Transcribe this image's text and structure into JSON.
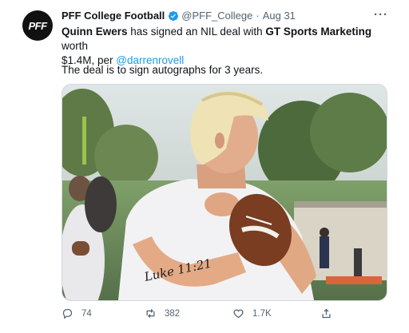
{
  "account": {
    "name": "PFF College Football",
    "handle": "@PFF_College",
    "separator": "·",
    "date": "Aug 31",
    "avatar_text": "PFF",
    "verified_icon": "verified-badge-icon",
    "accent_color": "#1d9bf0"
  },
  "tweet": {
    "player": "Quinn Ewers",
    "mid1": " has signed an NIL deal with ",
    "company": "GT Sports Marketing",
    "mid2": " worth",
    "line2_prefix": "$1.4M, per ",
    "mention": "@darrenrovell",
    "body2": "The deal is to sign autographs for 3 years.",
    "photo_text": "Luke 11:21"
  },
  "actions": {
    "reply_count": "74",
    "retweet_count": "382",
    "like_count": "1.7K",
    "icons": [
      "reply-icon",
      "retweet-icon",
      "like-icon",
      "share-icon"
    ]
  },
  "more_label": "···"
}
